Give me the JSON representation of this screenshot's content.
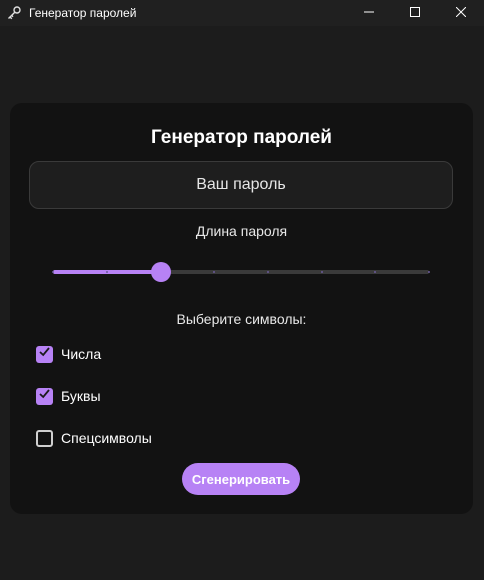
{
  "window": {
    "title": "Генератор паролей",
    "icon": "key-icon",
    "controls": [
      "minimize-icon",
      "maximize-icon",
      "close-icon"
    ]
  },
  "app": {
    "heading": "Генератор паролей",
    "password_field": {
      "value": "",
      "placeholder": "Ваш пароль"
    },
    "length_label": "Длина пароля",
    "length_slider": {
      "steps": 8,
      "selected_step": 2,
      "fraction": 0.286
    },
    "symbols_label": "Выберите символы:",
    "options": [
      {
        "label": "Числа",
        "checked": true
      },
      {
        "label": "Буквы",
        "checked": true
      },
      {
        "label": "Спецсимволы",
        "checked": false
      }
    ],
    "generate_label": "Сгенерировать"
  },
  "colors": {
    "accent": "#b782f5",
    "background": "#1c1c1c",
    "card": "#121212",
    "field": "#1e1e1e"
  }
}
